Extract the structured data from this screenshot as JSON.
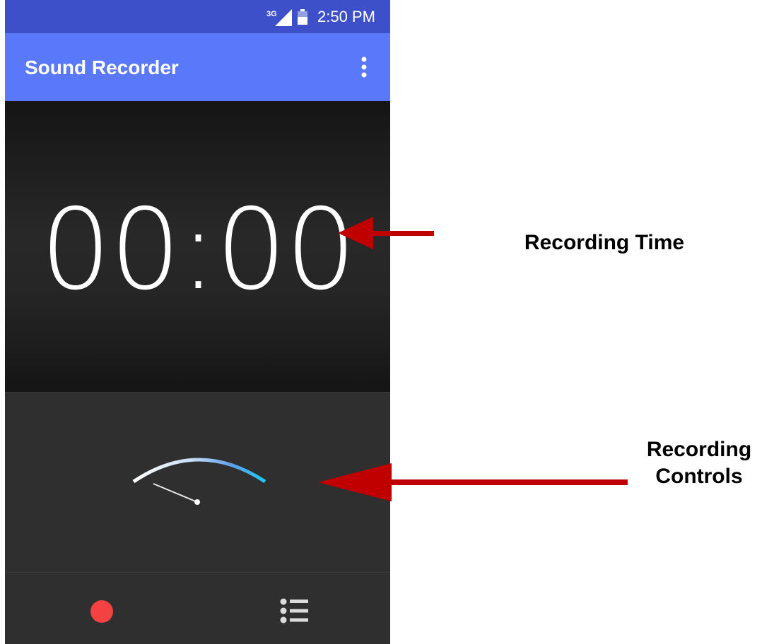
{
  "status_bar": {
    "network_label": "3G",
    "time": "2:50 PM",
    "icons": [
      "signal-icon",
      "battery-icon"
    ]
  },
  "app_bar": {
    "title": "Sound Recorder",
    "menu_icon": "more-vert-icon"
  },
  "timer": {
    "value": "00:00"
  },
  "controls": {
    "record_icon": "record-icon",
    "list_icon": "recordings-list-icon",
    "vu_meter_level": 0
  },
  "annotations": {
    "recording_time": "Recording Time",
    "recording_controls_line1": "Recording",
    "recording_controls_line2": "Controls"
  },
  "colors": {
    "status_bar": "#3e50c9",
    "app_bar": "#5a78fa",
    "record_button": "#f44242",
    "arrow": "#c00000",
    "meter_accent": "#2ab4f0"
  }
}
